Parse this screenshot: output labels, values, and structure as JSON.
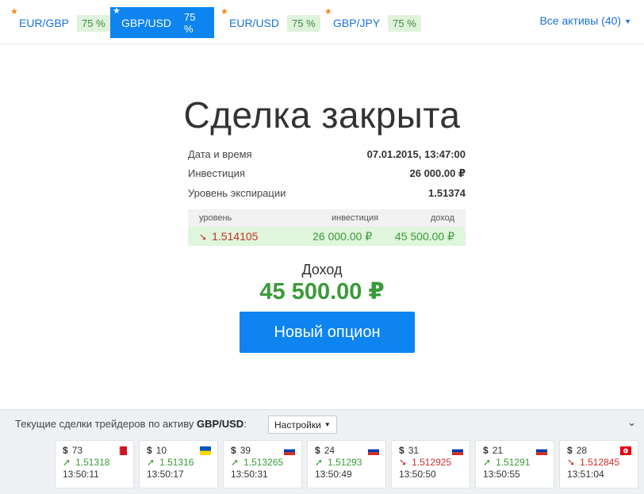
{
  "tabs": [
    {
      "name": "EUR/GBP",
      "pct": "75 %",
      "active": false
    },
    {
      "name": "GBP/USD",
      "pct": "75 %",
      "active": true
    },
    {
      "name": "EUR/USD",
      "pct": "75 %",
      "active": false
    },
    {
      "name": "GBP/JPY",
      "pct": "75 %",
      "active": false
    }
  ],
  "all_assets": "Все активы (40)",
  "title": "Сделка закрыта",
  "details": [
    {
      "label": "Дата и время",
      "value": "07.01.2015, 13:47:00"
    },
    {
      "label": "Инвестиция",
      "value": "26 000.00 ₽"
    },
    {
      "label": "Уровень экспирации",
      "value": "1.51374"
    }
  ],
  "mini": {
    "headers": [
      "уровень",
      "инвестиция",
      "доход"
    ],
    "level": "1.514105",
    "investment": "26 000.00 ₽",
    "income": "45 500.00 ₽"
  },
  "income_label": "Доход",
  "income_value": "45 500.00 ₽",
  "new_button": "Новый опцион",
  "footer": {
    "caption_prefix": "Текущие сделки трейдеров по активу ",
    "caption_asset": "GBP/USD",
    "caption_suffix": ":",
    "settings": "Настройки"
  },
  "trades": [
    {
      "amount": "73",
      "level": "1.51318",
      "dir": "up",
      "time": "13:50:11",
      "flag": "bahrain"
    },
    {
      "amount": "10",
      "level": "1.51316",
      "dir": "up",
      "time": "13:50:17",
      "flag": "ukraine"
    },
    {
      "amount": "39",
      "level": "1.513265",
      "dir": "up",
      "time": "13:50:31",
      "flag": "russia"
    },
    {
      "amount": "24",
      "level": "1.51293",
      "dir": "up",
      "time": "13:50:49",
      "flag": "russia"
    },
    {
      "amount": "31",
      "level": "1.512925",
      "dir": "down",
      "time": "13:50:50",
      "flag": "russia"
    },
    {
      "amount": "21",
      "level": "1.51291",
      "dir": "up",
      "time": "13:50:55",
      "flag": "russia"
    },
    {
      "amount": "28",
      "level": "1.512845",
      "dir": "down",
      "time": "13:51:04",
      "flag": "tunisia"
    }
  ]
}
